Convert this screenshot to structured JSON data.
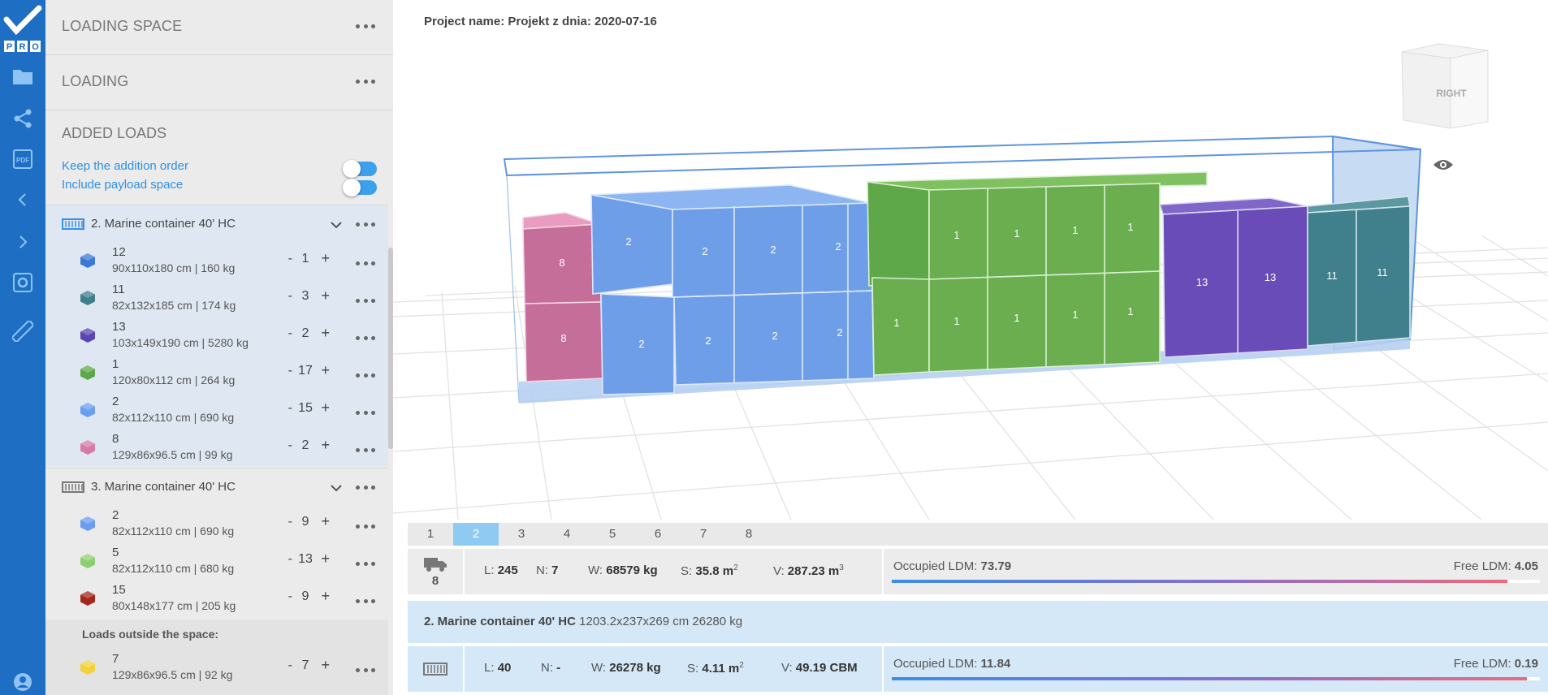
{
  "panel": {
    "loading_space_title": "LOADING SPACE",
    "loading_title": "LOADING",
    "added_loads_title": "ADDED LOADS",
    "option_keep_order": "Keep the addition order",
    "option_payload": "Include payload space",
    "containers": [
      {
        "name": "2. Marine container 40' HC",
        "items": [
          {
            "name": "12",
            "dims": "90x110x180 cm | 160 kg",
            "qty": "1",
            "color": "#3a78d6"
          },
          {
            "name": "11",
            "dims": "82x132x185 cm | 174 kg",
            "qty": "3",
            "color": "#3f7f8c"
          },
          {
            "name": "13",
            "dims": "103x149x190 cm | 5280 kg",
            "qty": "2",
            "color": "#5b44b3"
          },
          {
            "name": "1",
            "dims": "120x80x112 cm | 264 kg",
            "qty": "17",
            "color": "#5fa84a"
          },
          {
            "name": "2",
            "dims": "82x112x110 cm | 690 kg",
            "qty": "15",
            "color": "#6a9ef0"
          },
          {
            "name": "8",
            "dims": "129x86x96.5 cm | 99 kg",
            "qty": "2",
            "color": "#d67aa6"
          }
        ]
      },
      {
        "name": "3. Marine container 40' HC",
        "items": [
          {
            "name": "2",
            "dims": "82x112x110 cm | 690 kg",
            "qty": "9",
            "color": "#6a9ef0"
          },
          {
            "name": "5",
            "dims": "82x112x110 cm | 680 kg",
            "qty": "13",
            "color": "#8ccf70"
          },
          {
            "name": "15",
            "dims": "80x148x177 cm | 205 kg",
            "qty": "9",
            "color": "#a3281b"
          }
        ]
      }
    ],
    "outside_label": "Loads outside the space:",
    "outside_items": [
      {
        "name": "7",
        "dims": "129x86x96.5 cm | 92 kg",
        "qty": "7",
        "color": "#f2d23a"
      }
    ],
    "minus": "-",
    "plus": "+"
  },
  "main": {
    "project": "Project name: Projekt z dnia: 2020-07-16",
    "view_cube_label": "RIGHT",
    "pages": [
      "1",
      "2",
      "3",
      "4",
      "5",
      "6",
      "7",
      "8"
    ],
    "active_page": "2",
    "summary": {
      "count": "8",
      "L_label": "L:",
      "L": "245",
      "N_label": "N:",
      "N": "7",
      "W_label": "W:",
      "W": "68579 kg",
      "S_label": "S:",
      "S": "35.8 m",
      "V_label": "V:",
      "V": "287.23 m",
      "occ_label": "Occupied LDM:",
      "occ": "73.79",
      "free_label": "Free LDM:",
      "free": "4.05",
      "ldm_fraction": 0.95
    },
    "container_info": {
      "name": "2. Marine container 40' HC",
      "details": "1203.2x237x269 cm 26280 kg"
    },
    "container_stats": {
      "L": "40",
      "N": "-",
      "W": "26278 kg",
      "S": "4.11 m",
      "V": "49.19 CBM",
      "occ": "11.84",
      "free": "0.19",
      "ldm_fraction": 0.98
    },
    "box_labels": {
      "pink": "8",
      "blue": "2",
      "green": "1",
      "purple": "13",
      "teal": "11"
    }
  }
}
